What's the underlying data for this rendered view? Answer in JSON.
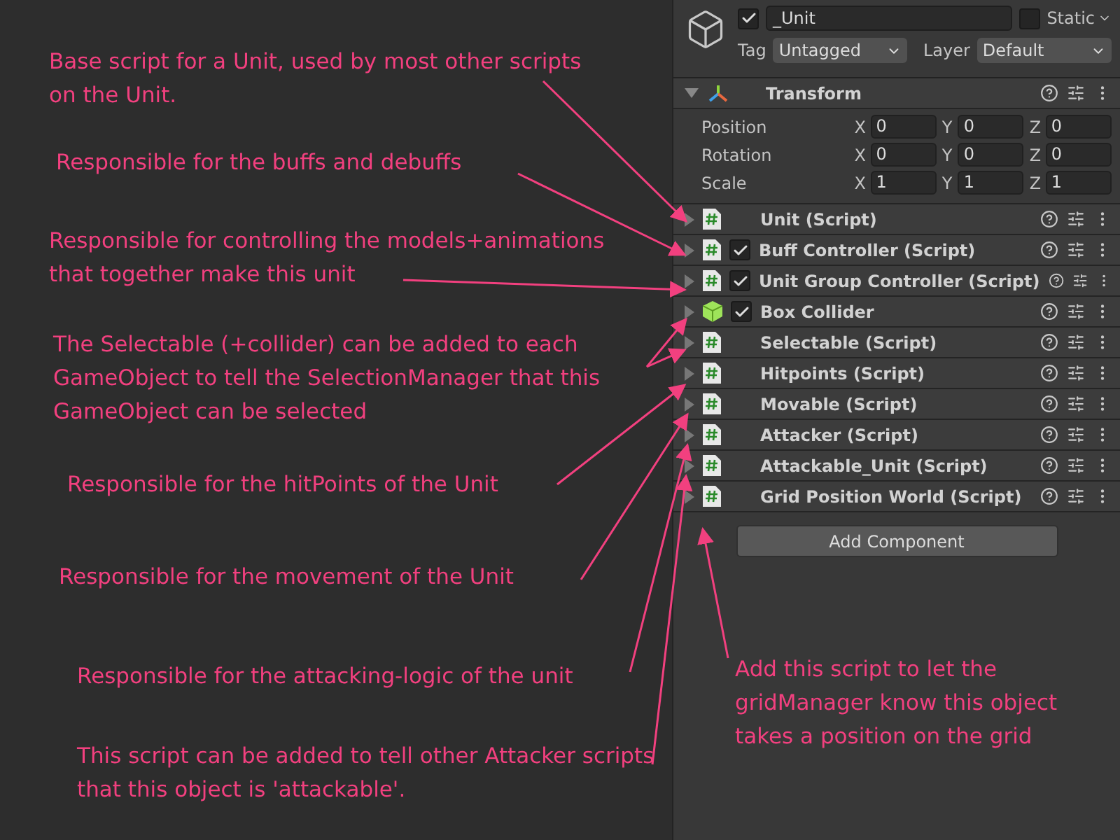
{
  "header": {
    "active": true,
    "name": "_Unit",
    "static": false,
    "static_label": "Static",
    "tag_label": "Tag",
    "tag": "Untagged",
    "layer_label": "Layer",
    "layer": "Default"
  },
  "transform": {
    "title": "Transform",
    "expanded": true,
    "rows": [
      {
        "label": "Position",
        "fields": [
          {
            "axis": "X",
            "value": "0"
          },
          {
            "axis": "Y",
            "value": "0"
          },
          {
            "axis": "Z",
            "value": "0"
          }
        ]
      },
      {
        "label": "Rotation",
        "fields": [
          {
            "axis": "X",
            "value": "0"
          },
          {
            "axis": "Y",
            "value": "0"
          },
          {
            "axis": "Z",
            "value": "0"
          }
        ]
      },
      {
        "label": "Scale",
        "fields": [
          {
            "axis": "X",
            "value": "1"
          },
          {
            "axis": "Y",
            "value": "1"
          },
          {
            "axis": "Z",
            "value": "1"
          }
        ]
      }
    ]
  },
  "components": [
    {
      "kind": "script",
      "name": "Unit (Script)"
    },
    {
      "kind": "script",
      "name": "Buff Controller (Script)",
      "enabled": true
    },
    {
      "kind": "script",
      "name": "Unit Group Controller (Script)",
      "enabled": true
    },
    {
      "kind": "collider",
      "name": "Box Collider",
      "enabled": true
    },
    {
      "kind": "script",
      "name": "Selectable (Script)"
    },
    {
      "kind": "script",
      "name": "Hitpoints (Script)"
    },
    {
      "kind": "script",
      "name": "Movable (Script)"
    },
    {
      "kind": "script",
      "name": "Attacker (Script)"
    },
    {
      "kind": "script",
      "name": "Attackable_Unit (Script)"
    },
    {
      "kind": "script",
      "name": "Grid Position World (Script)"
    }
  ],
  "add_component": "Add Component",
  "annotations": [
    {
      "lines": [
        "Base script for a Unit, used by most other scripts",
        "on the Unit."
      ]
    },
    {
      "lines": [
        "Responsible for the buffs and debuffs"
      ]
    },
    {
      "lines": [
        "Responsible for controlling the models+animations",
        "that together make this unit"
      ]
    },
    {
      "lines": [
        "The Selectable (+collider) can be added to each",
        "GameObject to tell the SelectionManager that this",
        "GameObject can be selected"
      ]
    },
    {
      "lines": [
        "Responsible for the hitPoints of the Unit"
      ]
    },
    {
      "lines": [
        "Responsible for the movement of the Unit"
      ]
    },
    {
      "lines": [
        "Responsible for the attacking-logic of the unit"
      ]
    },
    {
      "lines": [
        "This script can be added to tell other Attacker scripts",
        "that this object is 'attackable'."
      ]
    },
    {
      "lines": [
        "Add this script to let the",
        "gridManager know this object",
        "takes a position on the grid"
      ]
    }
  ]
}
